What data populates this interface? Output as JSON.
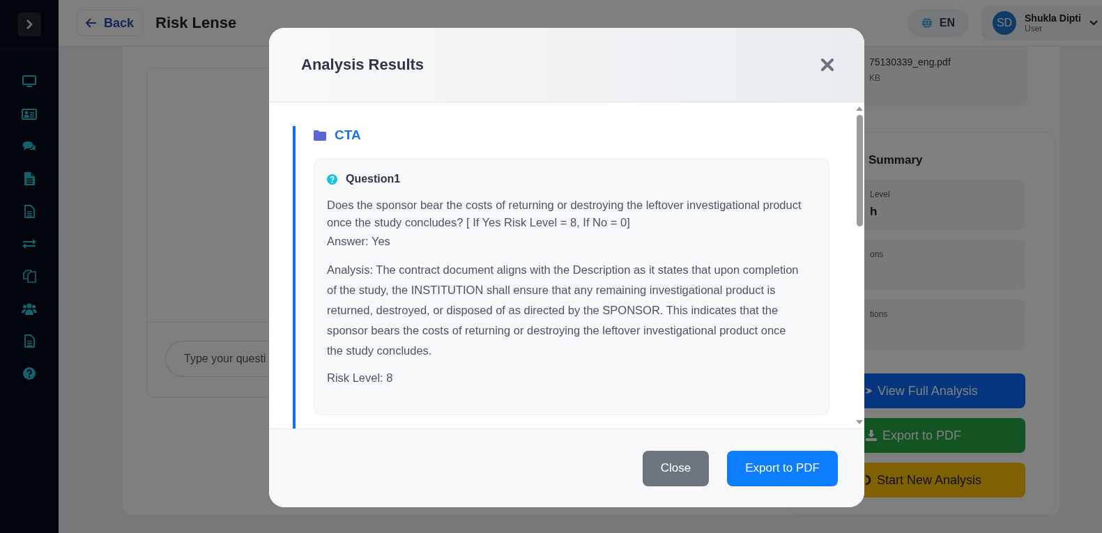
{
  "sidebar": {
    "items": [
      {
        "kind": "monitor"
      },
      {
        "kind": "idcard"
      },
      {
        "kind": "chat"
      },
      {
        "kind": "file"
      },
      {
        "kind": "fileoutline"
      },
      {
        "kind": "swap"
      },
      {
        "kind": "copy"
      },
      {
        "kind": "users"
      },
      {
        "kind": "fileoutline"
      },
      {
        "kind": "help"
      }
    ]
  },
  "header": {
    "back": "Back",
    "title": "Risk Lense",
    "language": "EN",
    "user": {
      "initials": "SD",
      "name": "Shukla Dipti",
      "role": "User"
    }
  },
  "chat": {
    "placeholder": "Type your questi"
  },
  "file": {
    "name": "75130339_eng.pdf",
    "size": "KB"
  },
  "summary": {
    "title": "Summary",
    "stats": [
      {
        "label": "Level",
        "value": "h"
      },
      {
        "label": "ons"
      },
      {
        "label": "tions"
      }
    ]
  },
  "actions": [
    {
      "label": "View Full Analysis",
      "kind": "view"
    },
    {
      "label": "Export to PDF",
      "kind": "export"
    },
    {
      "label": "Start New Analysis",
      "kind": "restart"
    }
  ],
  "modal": {
    "title": "Analysis Results",
    "sections": [
      {
        "title": "CTA",
        "questions": [
          {
            "title": "Question1",
            "text": "Does the sponsor bear the costs of returning or destroying the leftover investigational product once the study concludes? [ If Yes Risk Level = 8, If No = 0]",
            "answer": "Answer: Yes",
            "analysis": "Analysis: The contract document aligns with the Description as it states that upon completion of the study, the INSTITUTION shall ensure that any remaining investigational product is returned, destroyed, or disposed of as directed by the SPONSOR. This indicates that the sponsor bears the costs of returning or destroying the leftover investigational product once the study concludes.",
            "risk": "Risk Level: 8"
          }
        ]
      }
    ],
    "buttons": [
      {
        "label": "Close",
        "kind": "secondary"
      },
      {
        "label": "Export to PDF",
        "kind": "primary"
      }
    ]
  }
}
